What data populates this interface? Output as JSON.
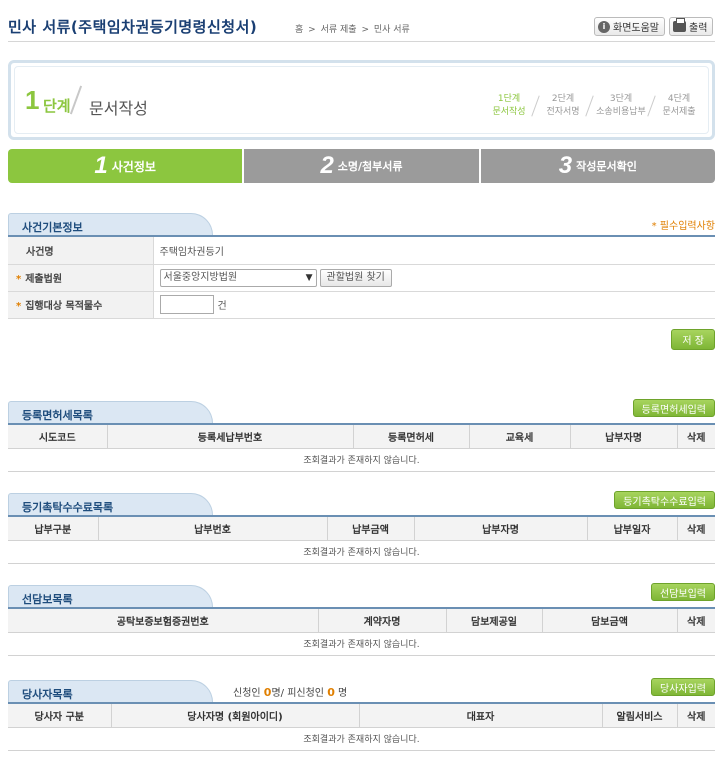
{
  "header": {
    "title": "민사 서류(주택임차권등기명령신청서)",
    "breadcrumb": [
      "홈",
      ">",
      "서류 제출",
      ">",
      "민사 서류"
    ],
    "help_button": "화면도움말",
    "print_button": "출력"
  },
  "step_box": {
    "step_number": "1",
    "step_label": "단계",
    "step_name": "문서작성",
    "mini_steps": [
      {
        "title": "1단계",
        "name": "문서작성"
      },
      {
        "title": "2단계",
        "name": "전자서명"
      },
      {
        "title": "3단계",
        "name": "소송비용납부"
      },
      {
        "title": "4단계",
        "name": "문서제출"
      }
    ]
  },
  "tabs": [
    {
      "num": "1",
      "label": "사건정보"
    },
    {
      "num": "2",
      "label": "소명/첨부서류"
    },
    {
      "num": "3",
      "label": "작성문서확인"
    }
  ],
  "case_info": {
    "title": "사건기본정보",
    "required_note": "* 필수입력사항",
    "case_name_label": "사건명",
    "case_name_value": "주택임차권등기",
    "court_label": "제출법원",
    "court_value": "서울중앙지방법원",
    "court_search_button": "관할법원 찾기",
    "property_count_label": "집행대상 목적물수",
    "property_count_value": "",
    "property_count_unit": "건",
    "save_button": "저 장"
  },
  "reg_tax": {
    "title": "등록면허세목록",
    "button": "등록면허세입력",
    "columns": [
      "시도코드",
      "등록세납부번호",
      "등록면허세",
      "교육세",
      "납부자명",
      "삭제"
    ],
    "empty": "조회결과가 존재하지 않습니다."
  },
  "reg_fee": {
    "title": "등기촉탁수수료목록",
    "button": "등기촉탁수수료입력",
    "columns": [
      "납부구분",
      "납부번호",
      "납부금액",
      "납부자명",
      "납부일자",
      "삭제"
    ],
    "empty": "조회결과가 존재하지 않습니다."
  },
  "collateral": {
    "title": "선담보목록",
    "button": "선담보입력",
    "columns": [
      "공탁보증보험증권번호",
      "계약자명",
      "담보제공일",
      "담보금액",
      "삭제"
    ],
    "empty": "조회결과가 존재하지 않습니다."
  },
  "parties": {
    "title": "당사자목록",
    "applicant_label": "신청인",
    "applicant_count": "0",
    "respondent_label": "명/ 피신청인",
    "respondent_count": "0",
    "unit": "명",
    "button": "당사자입력",
    "columns": [
      "당사자 구분",
      "당사자명 (회원아이디)",
      "대표자",
      "알림서비스",
      "삭제"
    ],
    "empty": "조회결과가 존재하지 않습니다."
  },
  "colors": {
    "accent_green": "#8cc63f",
    "title_blue": "#1a3f73",
    "required_orange": "#e07f00"
  }
}
